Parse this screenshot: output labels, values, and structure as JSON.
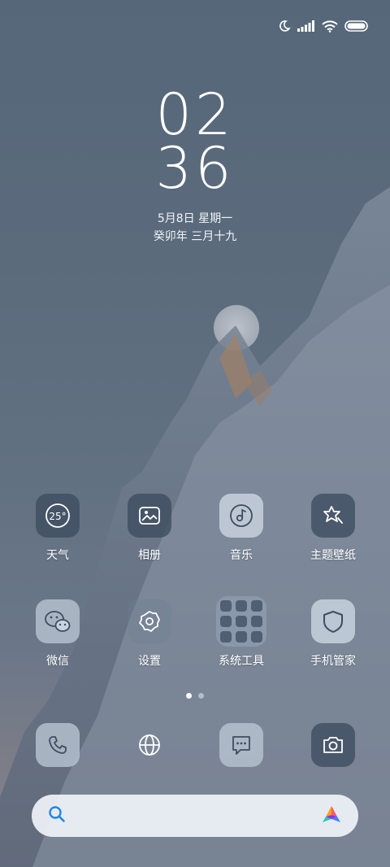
{
  "status_bar": {
    "icons": [
      "moon-icon",
      "signal-icon",
      "wifi-icon",
      "battery-icon"
    ]
  },
  "clock": {
    "hours": "02",
    "minutes": "36",
    "date": "5月8日 星期一",
    "lunar_date": "癸卯年 三月十九"
  },
  "apps_row1": [
    {
      "label": "天气",
      "icon": "weather-icon",
      "badge": "25°"
    },
    {
      "label": "相册",
      "icon": "gallery-icon"
    },
    {
      "label": "音乐",
      "icon": "music-icon"
    },
    {
      "label": "主题壁纸",
      "icon": "themes-icon"
    }
  ],
  "apps_row2": [
    {
      "label": "微信",
      "icon": "wechat-icon"
    },
    {
      "label": "设置",
      "icon": "settings-icon"
    },
    {
      "label": "系统工具",
      "icon": "folder-icon"
    },
    {
      "label": "手机管家",
      "icon": "security-icon"
    }
  ],
  "page_indicator": {
    "pages": 2,
    "current": 1
  },
  "dock": [
    {
      "icon": "phone-icon"
    },
    {
      "icon": "browser-icon"
    },
    {
      "icon": "messages-icon"
    },
    {
      "icon": "camera-icon"
    }
  ],
  "search_bar": {
    "left_icon": "search-icon",
    "right_icon": "assistant-logo-icon"
  }
}
